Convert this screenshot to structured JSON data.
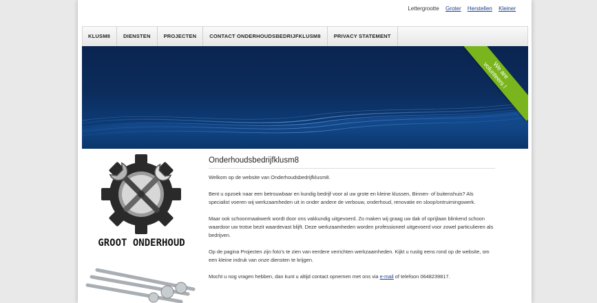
{
  "font_size_control": {
    "label": "Lettergrootte",
    "larger": "Groter",
    "reset": "Herstellen",
    "smaller": "Kleiner"
  },
  "nav": {
    "items": [
      {
        "label": "KLUSM8"
      },
      {
        "label": "DIENSTEN"
      },
      {
        "label": "PROJECTEN"
      },
      {
        "label": "CONTACT ONDERHOUDSBEDRIJFKLUSM8"
      },
      {
        "label": "PRIVACY STATEMENT"
      }
    ]
  },
  "banner": {
    "ribbon_line1": "We are",
    "ribbon_line2": "volunteers !"
  },
  "logo": {
    "caption": "GROOT ONDERHOUD"
  },
  "content": {
    "title": "Onderhoudsbedrijfklusm8",
    "p1": "Welkom op de website van Onderhoudsbedrijfklusm8.",
    "p2": "Bent u opzoek naar een betrouwbaar en kundig bedrijf voor al uw grote en kleine klussen, Binnen- of buitenshuis? Als specialist voeren wij werkzaamheden uit in onder andere de verbouw, onderhoud, renovatie en sloop/ontruimingswerk.",
    "p3": "Maar ook schoonmaakwerk wordt door ons vakkundig uitgevoerd. Zo maken wij graag uw dak of oprijlaan blinkend schoon waardoor uw trotse bezit waardevast blijft. Deze werkzaamheden worden professioneel uitgevoerd voor zowel particulieren als bedrijven.",
    "p4": "Op de pagina Projecten zijn foto's te zien van eerdere verrichten werkzaamheden. Kijkt u rustig eens rond op de website, om een kleine indruk van onze diensten te krijgen.",
    "p5_before": "Mocht u nog vragen hebben, dan kunt u altijd contact opnemen met ons via ",
    "p5_link": "e-mail",
    "p5_after": " of telefoon 0648239817."
  }
}
